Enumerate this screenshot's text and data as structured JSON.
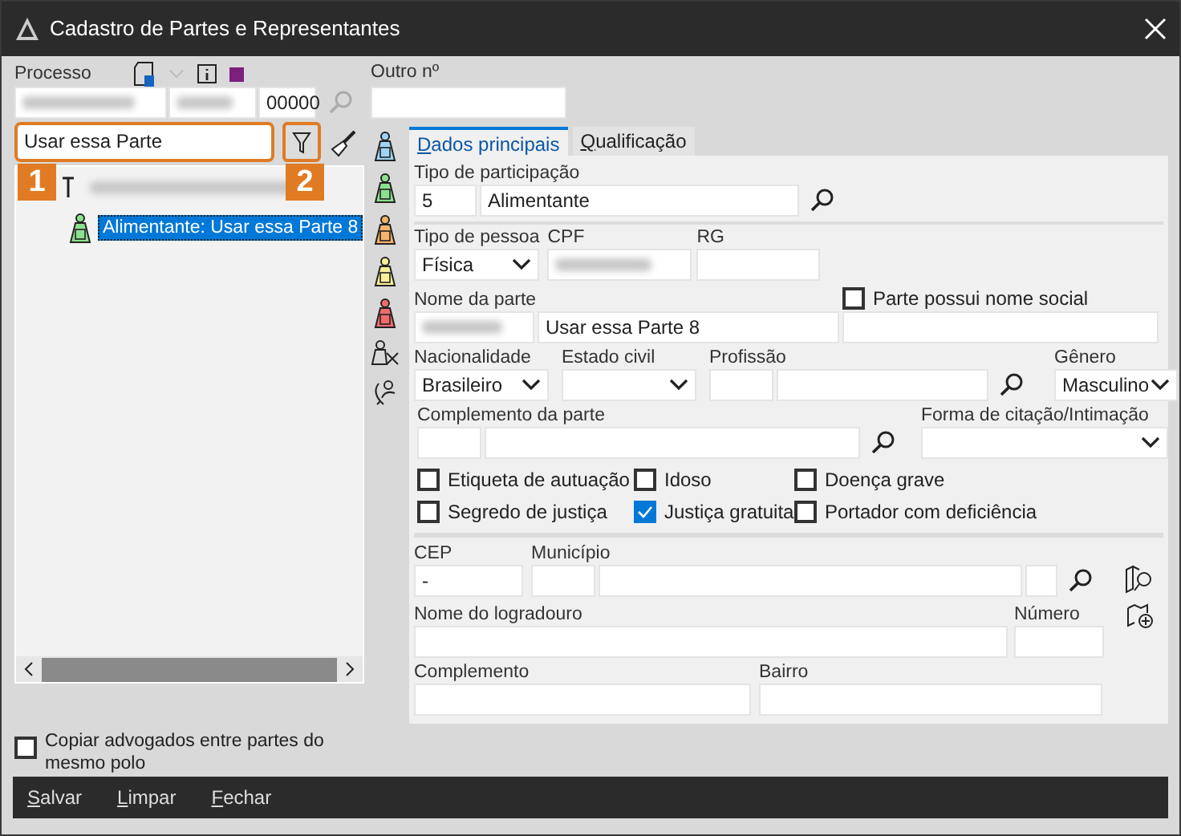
{
  "window": {
    "title": "Cadastro de Partes e Representantes"
  },
  "header": {
    "processo_label": "Processo",
    "processo_suffix": "00000",
    "outro_label": "Outro nº"
  },
  "search": {
    "value": "Usar essa Parte"
  },
  "callouts": [
    "1",
    "2"
  ],
  "tree": [
    {
      "selected": false,
      "children": [
        {
          "label": "Alimentante: Usar essa Parte 8",
          "selected": true
        }
      ]
    }
  ],
  "tabs": [
    {
      "label": "Dados principais",
      "selected": true
    },
    {
      "label": "Qualificação",
      "selected": false
    }
  ],
  "form": {
    "tipo_participacao": {
      "label": "Tipo de participação",
      "code": "5",
      "value": "Alimentante"
    },
    "tipo_pessoa": {
      "label": "Tipo de pessoa",
      "value": "Física"
    },
    "cpf": {
      "label": "CPF"
    },
    "rg": {
      "label": "RG"
    },
    "nome_parte": {
      "label": "Nome da parte",
      "value": "Usar essa Parte 8"
    },
    "nome_social": {
      "label": "Parte possui nome social",
      "checked": false
    },
    "nacionalidade": {
      "label": "Nacionalidade",
      "value": "Brasileiro"
    },
    "estado_civil": {
      "label": "Estado civil"
    },
    "profissao": {
      "label": "Profissão"
    },
    "genero": {
      "label": "Gênero",
      "value": "Masculino"
    },
    "complemento_parte": {
      "label": "Complemento da parte"
    },
    "forma_citacao": {
      "label": "Forma de citação/Intimação"
    },
    "flags": [
      {
        "label": "Etiqueta de autuação",
        "checked": false
      },
      {
        "label": "Idoso",
        "checked": false
      },
      {
        "label": "Doença grave",
        "checked": false
      },
      {
        "label": "Segredo de justiça",
        "checked": false
      },
      {
        "label": "Justiça gratuita",
        "checked": true
      },
      {
        "label": "Portador com deficiência",
        "checked": false
      }
    ],
    "cep": {
      "label": "CEP",
      "value": "-"
    },
    "municipio": {
      "label": "Município"
    },
    "logradouro": {
      "label": "Nome do logradouro"
    },
    "numero": {
      "label": "Número"
    },
    "complemento": {
      "label": "Complemento"
    },
    "bairro": {
      "label": "Bairro"
    }
  },
  "copy_lawyers": {
    "label": "Copiar advogados entre partes do mesmo polo",
    "checked": false
  },
  "footer_buttons": [
    {
      "label": "Salvar"
    },
    {
      "label": "Limpar"
    },
    {
      "label": "Fechar"
    }
  ]
}
